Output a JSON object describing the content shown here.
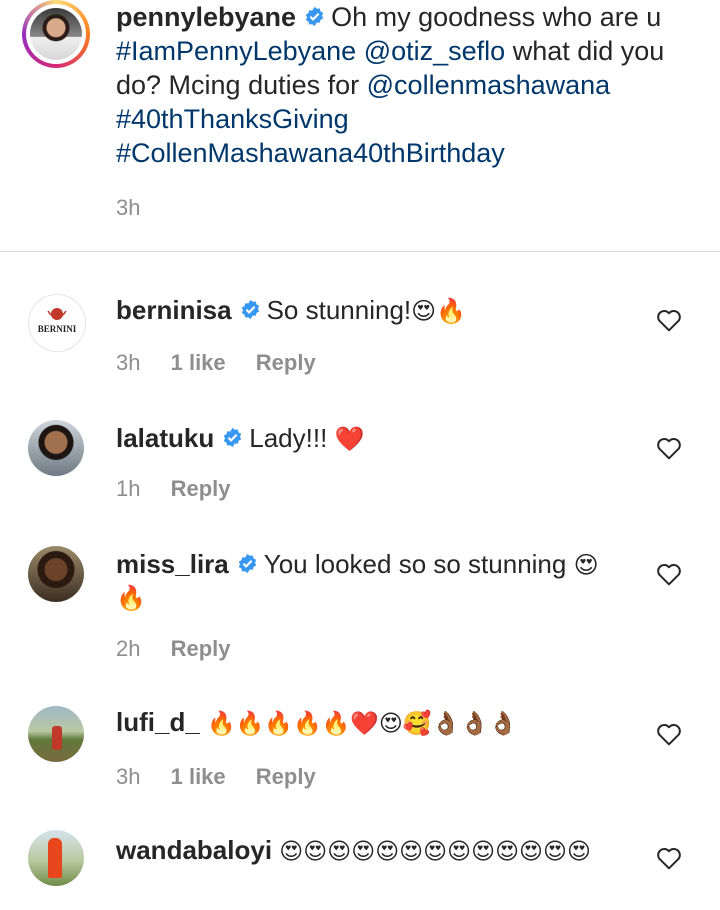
{
  "caption": {
    "username": "pennylebyane",
    "text_parts": [
      {
        "type": "text",
        "value": "Oh my goodness who are u "
      },
      {
        "type": "link",
        "value": "#IamPennyLebyane"
      },
      {
        "type": "text",
        "value": " "
      },
      {
        "type": "link",
        "value": "@otiz_seflo"
      },
      {
        "type": "text",
        "value": " what did you do? Mcing duties for "
      },
      {
        "type": "link",
        "value": "@collenmashawana"
      },
      {
        "type": "text",
        "value": " "
      },
      {
        "type": "link",
        "value": "#40thThanksGiving"
      },
      {
        "type": "text",
        "value": " "
      },
      {
        "type": "link",
        "value": "#CollenMashawana40thBirthday"
      }
    ],
    "time": "3h"
  },
  "comments": [
    {
      "username": "berninisa",
      "verified": true,
      "text": "So stunning!",
      "emoji": "😍🔥",
      "time": "3h",
      "likes": "1 like",
      "reply": "Reply",
      "avatar": "bernini-logo",
      "avatar_text": "BERNINI"
    },
    {
      "username": "lalatuku",
      "verified": true,
      "text": "Lady!!!",
      "emoji": "❤️",
      "time": "1h",
      "likes": "",
      "reply": "Reply",
      "avatar": "profile-photo"
    },
    {
      "username": "miss_lira",
      "verified": true,
      "text": "You looked so so stunning",
      "emoji": "😍 🔥",
      "time": "2h",
      "likes": "",
      "reply": "Reply",
      "avatar": "profile-photo"
    },
    {
      "username": "lufi_d_",
      "verified": false,
      "text": "",
      "emoji": "🔥🔥🔥🔥🔥❤️😍🥰👌🏾👌🏾👌🏾",
      "time": "3h",
      "likes": "1 like",
      "reply": "Reply",
      "avatar": "profile-photo"
    },
    {
      "username": "wandabaloyi",
      "verified": false,
      "text": "",
      "emoji": "😍😍😍😍😍😍😍😍😍😍😍😍😍",
      "time": "",
      "likes": "",
      "reply": "",
      "avatar": "profile-photo"
    }
  ],
  "colors": {
    "link": "#00376b",
    "verified": "#3897f0",
    "secondary": "#8e8e8e",
    "text": "#262626"
  }
}
